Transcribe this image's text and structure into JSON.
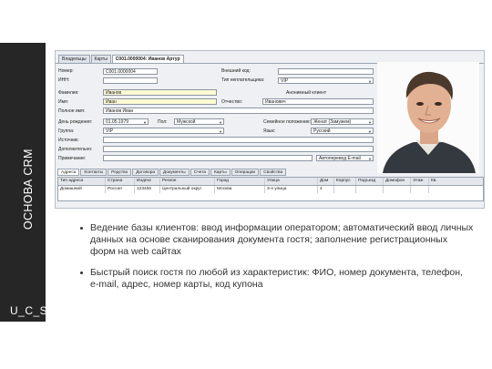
{
  "sidebar": {
    "title": "ОСНОВА CRM",
    "logo": "U_C_S"
  },
  "app": {
    "tabs": [
      "Владельцы",
      "Карты",
      "С001.0000004: Иванов Артур"
    ],
    "form": {
      "number_label": "Номер:",
      "number_value": "С001.0000004",
      "inn_label": "ИНН:",
      "external_code_label": "Внешний код:",
      "payer_type_label": "Тип неплательщика:",
      "payer_type_value": "VIP",
      "surname_label": "Фамилия:",
      "surname_value": "Иванов",
      "anon_label": "Анонимный клиент",
      "name_label": "Имя:",
      "name_value": "Иван",
      "patronymic_label": "Отчество:",
      "patronymic_value": "Иванович",
      "fullname_label": "Полное имя:",
      "fullname_value": "Иванов Иван",
      "birthday_label": "День рождения:",
      "birthday_value": "01.05.1979",
      "sex_label": "Пол:",
      "sex_value": "Мужской",
      "family_label": "Семейное положение:",
      "family_value": "Женат (Замужем)",
      "group_label": "Группа:",
      "group_value": "VIP",
      "language_label": "Язык:",
      "language_value": "Русский",
      "source_label": "Источник:",
      "extra_label": "Дополнительно:",
      "note_label": "Примечание:",
      "autotransfer_value": "Автоперевод E-mail"
    },
    "subtabs": [
      "Адреса",
      "Контакты",
      "Родство",
      "Договора",
      "Документы",
      "Счета",
      "Карты",
      "Операции",
      "Свойства"
    ],
    "grid": {
      "headers": [
        "Тип адреса",
        "Страна",
        "Индекс",
        "Регион",
        "Город",
        "Улица",
        "Дом",
        "Корпус",
        "Подъезд",
        "Домофон",
        "Этаж",
        "Кв."
      ],
      "rows": [
        [
          "Домашний",
          "Россия",
          "123456",
          "Центральный округ",
          "Москва",
          "3-я улица",
          "4",
          "",
          "",
          "",
          "",
          ""
        ]
      ]
    }
  },
  "bullets": [
    "Ведение базы клиентов: ввод информации оператором;  автоматический ввод личных данных на основе сканирования документа гостя; заполнение регистрационных форм на web сайтах",
    "Быстрый поиск гостя по любой из характеристик: ФИО, номер документа, телефон, e-mail, адрес, номер карты, код купона"
  ]
}
